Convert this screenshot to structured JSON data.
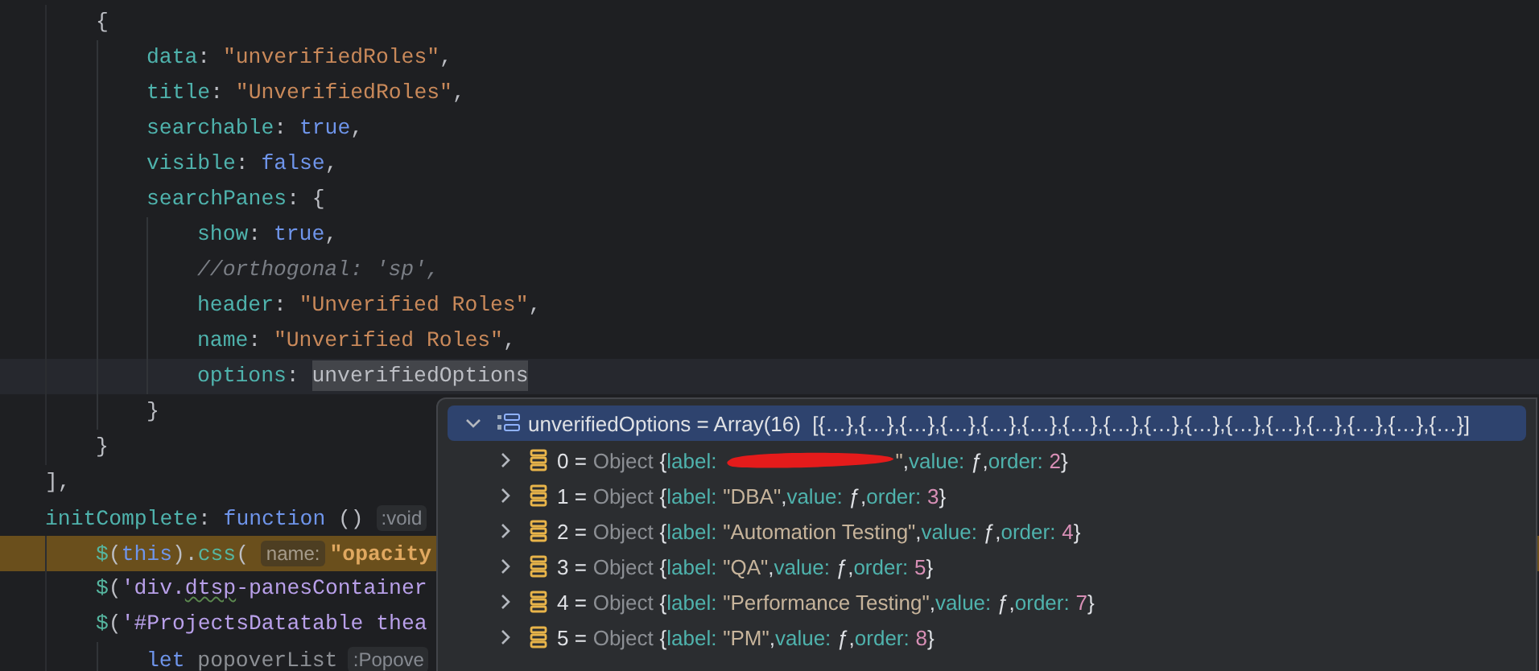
{
  "editor": {
    "lines": [
      {
        "children": [
          {
            "caret_line": false,
            "paused": false,
            "tokens": [
              {
                "kind": "punct",
                "text": "{"
              }
            ],
            "children": [
              {
                "caret_line": false,
                "paused": false,
                "tokens": [
                  {
                    "kind": "key",
                    "text": "data"
                  },
                  {
                    "kind": "punct",
                    "text": ": "
                  },
                  {
                    "kind": "string",
                    "text": "\"unverifiedRoles\""
                  },
                  {
                    "kind": "punct",
                    "text": ","
                  }
                ]
              },
              {
                "caret_line": false,
                "paused": false,
                "tokens": [
                  {
                    "kind": "key",
                    "text": "title"
                  },
                  {
                    "kind": "punct",
                    "text": ": "
                  },
                  {
                    "kind": "string",
                    "text": "\"UnverifiedRoles\""
                  },
                  {
                    "kind": "punct",
                    "text": ","
                  }
                ]
              },
              {
                "caret_line": false,
                "paused": false,
                "tokens": [
                  {
                    "kind": "key",
                    "text": "searchable"
                  },
                  {
                    "kind": "punct",
                    "text": ": "
                  },
                  {
                    "kind": "keyword",
                    "text": "true"
                  },
                  {
                    "kind": "punct",
                    "text": ","
                  }
                ]
              },
              {
                "caret_line": false,
                "paused": false,
                "tokens": [
                  {
                    "kind": "key",
                    "text": "visible"
                  },
                  {
                    "kind": "punct",
                    "text": ": "
                  },
                  {
                    "kind": "keyword",
                    "text": "false"
                  },
                  {
                    "kind": "punct",
                    "text": ","
                  }
                ]
              },
              {
                "caret_line": false,
                "paused": false,
                "tokens": [
                  {
                    "kind": "key",
                    "text": "searchPanes"
                  },
                  {
                    "kind": "punct",
                    "text": ": {"
                  }
                ],
                "children": [
                  {
                    "caret_line": false,
                    "paused": false,
                    "tokens": [
                      {
                        "kind": "key",
                        "text": "show"
                      },
                      {
                        "kind": "punct",
                        "text": ": "
                      },
                      {
                        "kind": "keyword",
                        "text": "true"
                      },
                      {
                        "kind": "punct",
                        "text": ","
                      }
                    ]
                  },
                  {
                    "caret_line": false,
                    "paused": false,
                    "tokens": [
                      {
                        "kind": "comment",
                        "text": "//orthogonal: 'sp',"
                      }
                    ]
                  },
                  {
                    "caret_line": false,
                    "paused": false,
                    "tokens": [
                      {
                        "kind": "key",
                        "text": "header"
                      },
                      {
                        "kind": "punct",
                        "text": ": "
                      },
                      {
                        "kind": "string",
                        "text": "\"Unverified Roles\""
                      },
                      {
                        "kind": "punct",
                        "text": ","
                      }
                    ]
                  },
                  {
                    "caret_line": false,
                    "paused": false,
                    "tokens": [
                      {
                        "kind": "key",
                        "text": "name"
                      },
                      {
                        "kind": "punct",
                        "text": ": "
                      },
                      {
                        "kind": "string",
                        "text": "\"Unverified Roles\""
                      },
                      {
                        "kind": "punct",
                        "text": ","
                      }
                    ]
                  },
                  {
                    "caret_line": true,
                    "paused": false,
                    "tokens": [
                      {
                        "kind": "key",
                        "text": "options"
                      },
                      {
                        "kind": "punct",
                        "text": ": "
                      },
                      {
                        "kind": "hovered",
                        "text": "unverifiedOptions"
                      }
                    ]
                  }
                ]
              },
              {
                "caret_line": false,
                "paused": false,
                "tokens": [
                  {
                    "kind": "punct",
                    "text": "}"
                  }
                ]
              }
            ]
          },
          {
            "caret_line": false,
            "paused": false,
            "tokens": [
              {
                "kind": "punct",
                "text": "}"
              }
            ]
          }
        ]
      },
      {
        "caret_line": false,
        "paused": false,
        "tokens": [
          {
            "kind": "punct",
            "text": "],"
          }
        ]
      },
      {
        "caret_line": false,
        "paused": false,
        "tokens": [
          {
            "kind": "key",
            "text": "initComplete"
          },
          {
            "kind": "punct",
            "text": ": "
          },
          {
            "kind": "keyword",
            "text": "function"
          },
          {
            "kind": "punct",
            "text": " () "
          },
          {
            "kind": "hint",
            "text": ":void"
          }
        ],
        "children": [
          {
            "caret_line": false,
            "paused": true,
            "tokens": [
              {
                "kind": "call",
                "text": "$"
              },
              {
                "kind": "punct",
                "text": "("
              },
              {
                "kind": "keyword",
                "text": "this"
              },
              {
                "kind": "punct",
                "text": ")."
              },
              {
                "kind": "call",
                "text": "css"
              },
              {
                "kind": "punct",
                "text": "( "
              },
              {
                "kind": "hint",
                "text": "name:"
              },
              {
                "kind": "string",
                "text": "\"opacity"
              }
            ]
          },
          {
            "caret_line": false,
            "paused": false,
            "tokens": [
              {
                "kind": "call",
                "text": "$"
              },
              {
                "kind": "punct",
                "text": "("
              },
              {
                "kind": "selector",
                "text": "'div."
              },
              {
                "kind": "typo",
                "text": "dtsp"
              },
              {
                "kind": "selector",
                "text": "-panesContainer"
              }
            ]
          },
          {
            "caret_line": false,
            "paused": false,
            "tokens": [
              {
                "kind": "call",
                "text": "$"
              },
              {
                "kind": "punct",
                "text": "("
              },
              {
                "kind": "selector",
                "text": "'#ProjectsDatatable thea"
              }
            ],
            "children": [
              {
                "caret_line": false,
                "paused": false,
                "tokens": [
                  {
                    "kind": "keyword",
                    "text": "let"
                  },
                  {
                    "kind": "unused",
                    "text": "popoverList"
                  },
                  {
                    "kind": "hint",
                    "text": ":Popove"
                  }
                ]
              }
            ]
          }
        ]
      }
    ]
  },
  "debug_popup": {
    "header": {
      "expanded": true,
      "text": "unverifiedOptions = Array(16)  [{…},{…},{…},{…},{…},{…},{…},{…},{…},{…},{…},{…},{…},{…},{…},{…}]"
    },
    "items": [
      {
        "expanded": false,
        "tokens": [
          {
            "kind": "index",
            "text": "0 ="
          },
          {
            "kind": "type",
            "text": "Object"
          },
          {
            "kind": "punct",
            "text": "{"
          },
          {
            "kind": "key",
            "text": "label:"
          },
          {
            "kind": "redaction"
          },
          {
            "kind": "string",
            "text": "\""
          },
          {
            "kind": "punct",
            "text": ","
          },
          {
            "kind": "key",
            "text": "value:"
          },
          {
            "kind": "punct",
            "text": "ƒ,"
          },
          {
            "kind": "key",
            "text": "order:"
          },
          {
            "kind": "number",
            "text": "2"
          },
          {
            "kind": "punct",
            "text": "}"
          }
        ]
      },
      {
        "expanded": false,
        "tokens": [
          {
            "kind": "index",
            "text": "1 ="
          },
          {
            "kind": "type",
            "text": "Object"
          },
          {
            "kind": "punct",
            "text": "{"
          },
          {
            "kind": "key",
            "text": "label:"
          },
          {
            "kind": "string",
            "text": "\"DBA\""
          },
          {
            "kind": "punct",
            "text": ","
          },
          {
            "kind": "key",
            "text": "value:"
          },
          {
            "kind": "punct",
            "text": "ƒ,"
          },
          {
            "kind": "key",
            "text": "order:"
          },
          {
            "kind": "number",
            "text": "3"
          },
          {
            "kind": "punct",
            "text": "}"
          }
        ]
      },
      {
        "expanded": false,
        "tokens": [
          {
            "kind": "index",
            "text": "2 ="
          },
          {
            "kind": "type",
            "text": "Object"
          },
          {
            "kind": "punct",
            "text": "{"
          },
          {
            "kind": "key",
            "text": "label:"
          },
          {
            "kind": "string",
            "text": "\"Automation Testing\""
          },
          {
            "kind": "punct",
            "text": ","
          },
          {
            "kind": "key",
            "text": "value:"
          },
          {
            "kind": "punct",
            "text": "ƒ,"
          },
          {
            "kind": "key",
            "text": "order:"
          },
          {
            "kind": "number",
            "text": "4"
          },
          {
            "kind": "punct",
            "text": "}"
          }
        ]
      },
      {
        "expanded": false,
        "tokens": [
          {
            "kind": "index",
            "text": "3 ="
          },
          {
            "kind": "type",
            "text": "Object"
          },
          {
            "kind": "punct",
            "text": "{"
          },
          {
            "kind": "key",
            "text": "label:"
          },
          {
            "kind": "string",
            "text": "\"QA\""
          },
          {
            "kind": "punct",
            "text": ","
          },
          {
            "kind": "key",
            "text": "value:"
          },
          {
            "kind": "punct",
            "text": "ƒ,"
          },
          {
            "kind": "key",
            "text": "order:"
          },
          {
            "kind": "number",
            "text": "5"
          },
          {
            "kind": "punct",
            "text": "}"
          }
        ]
      },
      {
        "expanded": false,
        "tokens": [
          {
            "kind": "index",
            "text": "4 ="
          },
          {
            "kind": "type",
            "text": "Object"
          },
          {
            "kind": "punct",
            "text": "{"
          },
          {
            "kind": "key",
            "text": "label:"
          },
          {
            "kind": "string",
            "text": "\"Performance Testing\""
          },
          {
            "kind": "punct",
            "text": ","
          },
          {
            "kind": "key",
            "text": "value:"
          },
          {
            "kind": "punct",
            "text": "ƒ,"
          },
          {
            "kind": "key",
            "text": "order:"
          },
          {
            "kind": "number",
            "text": "7"
          },
          {
            "kind": "punct",
            "text": "}"
          }
        ]
      },
      {
        "expanded": false,
        "tokens": [
          {
            "kind": "index",
            "text": "5 ="
          },
          {
            "kind": "type",
            "text": "Object"
          },
          {
            "kind": "punct",
            "text": "{"
          },
          {
            "kind": "key",
            "text": "label:"
          },
          {
            "kind": "string",
            "text": "\"PM\""
          },
          {
            "kind": "punct",
            "text": ","
          },
          {
            "kind": "key",
            "text": "value:"
          },
          {
            "kind": "punct",
            "text": "ƒ,"
          },
          {
            "kind": "key",
            "text": "order:"
          },
          {
            "kind": "number",
            "text": "8"
          },
          {
            "kind": "punct",
            "text": "}"
          }
        ]
      }
    ]
  }
}
